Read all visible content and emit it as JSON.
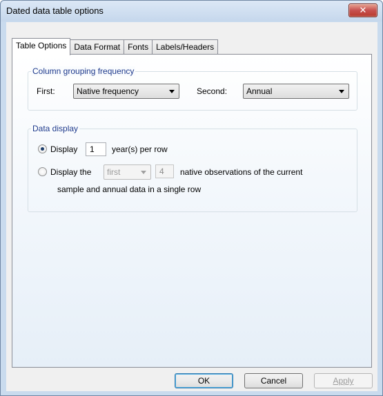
{
  "window": {
    "title": "Dated data table options",
    "close_glyph": "✕"
  },
  "tabs": [
    "Table Options",
    "Data Format",
    "Fonts",
    "Labels/Headers"
  ],
  "grouping": {
    "legend": "Column grouping frequency",
    "first_label": "First:",
    "first_value": "Native frequency",
    "second_label": "Second:",
    "second_value": "Annual"
  },
  "display": {
    "legend": "Data display",
    "option1_label": "Display",
    "option1_value": "1",
    "option1_suffix": "year(s) per row",
    "option1_checked": true,
    "option2_label": "Display the",
    "option2_combo": "first",
    "option2_value": "4",
    "option2_suffix": "native observations of the current",
    "option2_line2": "sample and annual data in a single row",
    "option2_checked": false
  },
  "buttons": {
    "ok": "OK",
    "cancel": "Cancel",
    "apply": "Apply"
  },
  "colors": {
    "accent": "#1e3a8c",
    "close": "#c75050"
  }
}
